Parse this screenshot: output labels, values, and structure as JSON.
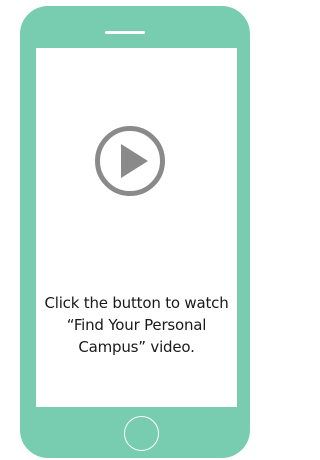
{
  "phone": {
    "body_color": "#78ccb0",
    "screen_color": "#ffffff"
  },
  "video": {
    "play_icon": "play-icon",
    "play_color": "#8a8a8a",
    "caption_lines": [
      "Click the button to watch",
      "“Find Your Personal",
      "Campus” video."
    ]
  },
  "home_button": {
    "icon": "home-button-circle"
  }
}
